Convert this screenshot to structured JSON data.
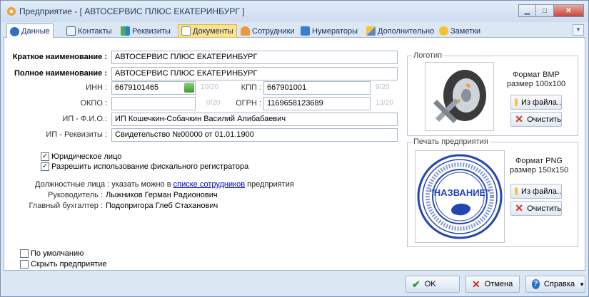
{
  "window": {
    "title": "Предприятие - [ АВТОСЕРВИС ПЛЮС ЕКАТЕРИНБУРГ ]"
  },
  "tabs": [
    {
      "label": "Данные",
      "icon": "data-icon"
    },
    {
      "label": "Контакты",
      "icon": "contacts-icon"
    },
    {
      "label": "Реквизиты",
      "icon": "requisites-icon"
    },
    {
      "label": "Документы",
      "icon": "documents-icon"
    },
    {
      "label": "Сотрудники",
      "icon": "employees-icon"
    },
    {
      "label": "Нумераторы",
      "icon": "numerators-icon"
    },
    {
      "label": "Дополнительно",
      "icon": "additional-icon"
    },
    {
      "label": "Заметки",
      "icon": "notes-icon"
    }
  ],
  "form": {
    "short_name_label": "Краткое наименование :",
    "short_name_value": "АВТОСЕРВИС ПЛЮС ЕКАТЕРИНБУРГ",
    "full_name_label": "Полное наименование :",
    "full_name_value": "АВТОСЕРВИС ПЛЮС ЕКАТЕРИНБУРГ",
    "inn_label": "ИНН :",
    "inn_value": "6679101465",
    "inn_counter": "10/20",
    "kpp_label": "КПП :",
    "kpp_value": "667901001",
    "kpp_counter": "9/20",
    "okpo_label": "ОКПО :",
    "okpo_value": "",
    "okpo_counter": "0/20",
    "ogrn_label": "ОГРН :",
    "ogrn_value": "1169658123689",
    "ogrn_counter": "13/20",
    "ip_fio_label": "ИП - Ф.И.О.:",
    "ip_fio_value": "ИП Кошечкин-Собачкин Василий Алибабаевич",
    "ip_req_label": "ИП - Реквизиты :",
    "ip_req_value": "Свидетельство №00000 от 01.01.1900"
  },
  "checkboxes": {
    "legal_entity": {
      "label": "Юридическое лицо",
      "checked": true
    },
    "fiscal": {
      "label": "Разрешить использование фискального регистратора",
      "checked": true
    },
    "default": {
      "label": "По умолчанию",
      "checked": false
    },
    "hide": {
      "label": "Скрыть предприятие",
      "checked": false
    }
  },
  "officials": {
    "hint_prefix": "Должностные лица : указать можно в",
    "hint_link": "списке сотрудников",
    "hint_suffix": "предприятия",
    "head_label": "Руководитель :",
    "head_value": "Лыжников Герман Радионович",
    "accountant_label": "Главный бухгалтер :",
    "accountant_value": "Подопригора Глеб Стаханович"
  },
  "logo": {
    "group_title": "Логотип",
    "format_line1": "Формат BMP",
    "format_line2": "размер 100x100",
    "from_file": "Из файла..",
    "clear": "Очистить"
  },
  "stamp": {
    "group_title": "Печать предприятия",
    "format_line1": "Формат PNG",
    "format_line2": "размер 150x150",
    "from_file": "Из файла..",
    "clear": "Очистить",
    "inner_text": "\"НАЗВАНИЕ\""
  },
  "footer": {
    "ok": "OK",
    "cancel": "Отмена",
    "help": "Справка"
  },
  "colors": {
    "accent": "#1e395b",
    "link": "#0000cc",
    "stamp_blue": "#2446b5"
  }
}
